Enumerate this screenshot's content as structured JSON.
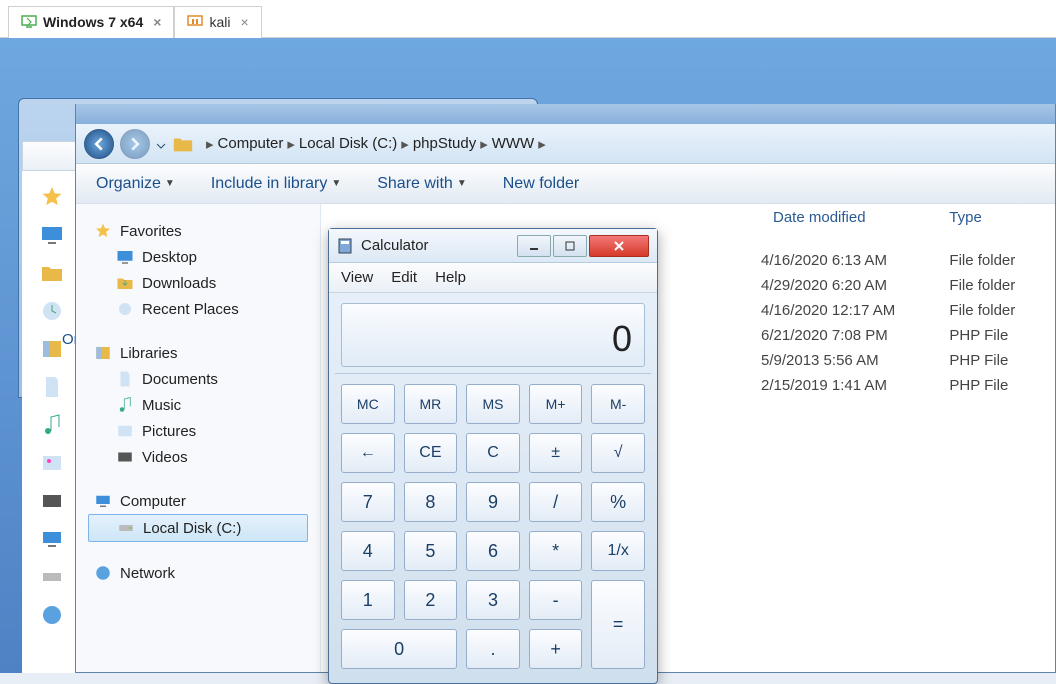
{
  "vm_tabs": [
    {
      "label": "Windows 7 x64",
      "active": true
    },
    {
      "label": "kali",
      "active": false
    }
  ],
  "bg": {
    "org": "Org"
  },
  "explorer": {
    "breadcrumb": [
      "Computer",
      "Local Disk (C:)",
      "phpStudy",
      "WWW"
    ],
    "toolbar": {
      "organize": "Organize",
      "include": "Include in library",
      "share": "Share with",
      "newfolder": "New folder"
    },
    "sidebar": {
      "favorites": "Favorites",
      "desktop": "Desktop",
      "downloads": "Downloads",
      "recent": "Recent Places",
      "libraries": "Libraries",
      "documents": "Documents",
      "music": "Music",
      "pictures": "Pictures",
      "videos": "Videos",
      "computer": "Computer",
      "localdisk": "Local Disk (C:)",
      "network": "Network"
    },
    "columns": {
      "date": "Date modified",
      "type": "Type"
    },
    "rows": [
      {
        "date": "4/16/2020 6:13 AM",
        "type": "File folder"
      },
      {
        "date": "4/29/2020 6:20 AM",
        "type": "File folder"
      },
      {
        "date": "4/16/2020 12:17 AM",
        "type": "File folder"
      },
      {
        "date": "6/21/2020 7:08 PM",
        "type": "PHP File"
      },
      {
        "date": "5/9/2013 5:56 AM",
        "type": "PHP File"
      },
      {
        "date": "2/15/2019 1:41 AM",
        "type": "PHP File"
      }
    ]
  },
  "calc": {
    "title": "Calculator",
    "menu": {
      "view": "View",
      "edit": "Edit",
      "help": "Help"
    },
    "display": "0",
    "keys": {
      "mc": "MC",
      "mr": "MR",
      "ms": "MS",
      "mplus": "M+",
      "mminus": "M-",
      "back": "←",
      "ce": "CE",
      "c": "C",
      "pm": "±",
      "sqrt": "√",
      "7": "7",
      "8": "8",
      "9": "9",
      "div": "/",
      "pct": "%",
      "4": "4",
      "5": "5",
      "6": "6",
      "mul": "*",
      "inv": "1/x",
      "1": "1",
      "2": "2",
      "3": "3",
      "sub": "-",
      "eq": "=",
      "0": "0",
      "dot": ".",
      "add": "+"
    }
  }
}
